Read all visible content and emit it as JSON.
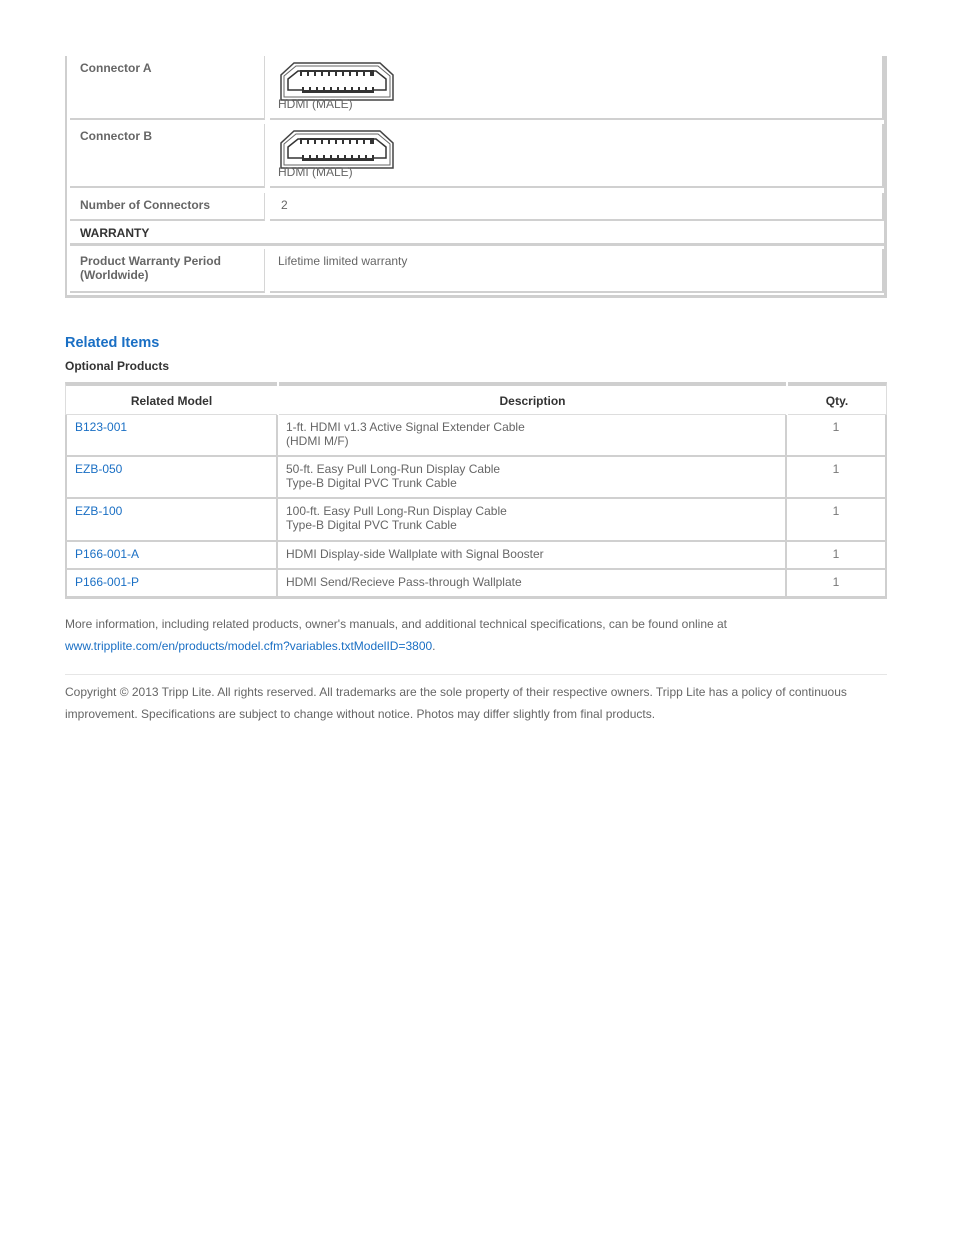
{
  "specs": {
    "rows": [
      {
        "label": "Connector A",
        "value": "HDMI (MALE)",
        "icon": "hdmi-connector-icon"
      },
      {
        "label": "Connector B",
        "value": "HDMI (MALE)",
        "icon": "hdmi-connector-icon"
      },
      {
        "label": "Number of Connectors",
        "value": "2"
      }
    ],
    "warranty_section": "WARRANTY",
    "warranty_rows": [
      {
        "label": "Product Warranty Period (Worldwide)",
        "value": "Lifetime limited warranty"
      }
    ]
  },
  "related": {
    "title": "Related Items",
    "subtitle": "Optional Products",
    "columns": [
      "Related Model",
      "Description",
      "Qty."
    ],
    "rows": [
      {
        "model": "B123-001",
        "description": [
          "1-ft. HDMI v1.3 Active Signal Extender Cable",
          "(HDMI M/F)"
        ],
        "qty": "1"
      },
      {
        "model": "EZB-050",
        "description": [
          "50-ft. Easy Pull Long-Run Display Cable",
          "Type-B Digital PVC Trunk Cable"
        ],
        "qty": "1"
      },
      {
        "model": "EZB-100",
        "description": [
          "100-ft. Easy Pull Long-Run Display Cable",
          "Type-B Digital PVC Trunk Cable"
        ],
        "qty": "1"
      },
      {
        "model": "P166-001-A",
        "description": [
          "HDMI Display-side Wallplate with Signal Booster"
        ],
        "qty": "1"
      },
      {
        "model": "P166-001-P",
        "description": [
          "HDMI Send/Recieve Pass-through Wallplate"
        ],
        "qty": "1"
      }
    ]
  },
  "footer": {
    "more_info_text": "More information, including related products, owner's manuals, and additional technical specifications, can be found online at",
    "more_info_link": "www.tripplite.com/en/products/model.cfm?variables.txtModelID=3800",
    "more_info_suffix": ".",
    "copyright": "Copyright © 2013 Tripp Lite. All rights reserved. All trademarks are the sole property of their respective owners. Tripp Lite has a policy of continuous improvement. Specifications are subject to change without notice. Photos may differ slightly from final products."
  },
  "colors": {
    "link": "#1a6fc4",
    "text": "#666666",
    "border": "#cfcfcf"
  }
}
